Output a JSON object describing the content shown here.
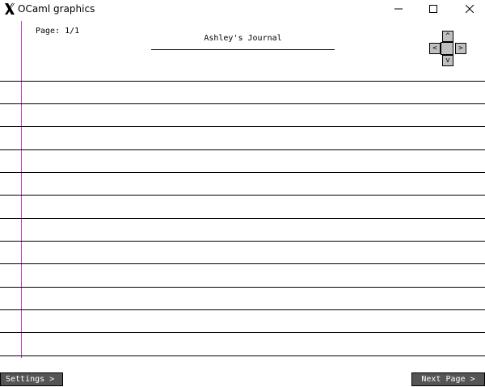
{
  "window": {
    "title": "OCaml graphics",
    "controls": {
      "minimize": "minimize-icon",
      "maximize": "maximize-icon",
      "close": "close-icon"
    }
  },
  "journal": {
    "page_label": "Page: 1/1",
    "title": "Ashley's Journal"
  },
  "dpad": {
    "up": "^",
    "left": "<",
    "right": ">",
    "down": "v"
  },
  "buttons": {
    "settings": "Settings >",
    "next_page": "Next Page >"
  },
  "colors": {
    "margin_line": "#c040c0",
    "dpad_fill": "#c0c0c0",
    "button_fill": "#555555",
    "button_text": "#ffffff"
  }
}
